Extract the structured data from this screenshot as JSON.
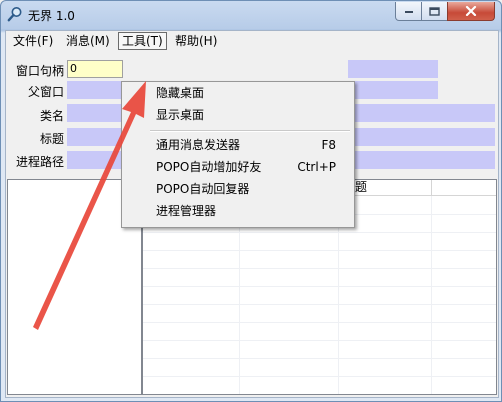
{
  "window": {
    "title": "无界 1.0"
  },
  "menu": {
    "file": "文件(F)",
    "message": "消息(M)",
    "tools": "工具(T)",
    "help": "帮助(H)"
  },
  "fields": {
    "hwnd_label": "窗口句柄",
    "hwnd_value": "0",
    "parent_label": "父窗口",
    "class_label": "类名",
    "title_label": "标题",
    "path_label": "进程路径"
  },
  "list": {
    "title_column": "标题"
  },
  "tools_menu": {
    "items": [
      {
        "label": "隐藏桌面",
        "shortcut": ""
      },
      {
        "label": "显示桌面",
        "shortcut": ""
      },
      {
        "label": "通用消息发送器",
        "shortcut": "F8"
      },
      {
        "label": "POPO自动增加好友",
        "shortcut": "Ctrl+P"
      },
      {
        "label": "POPO自动回复器",
        "shortcut": ""
      },
      {
        "label": "进程管理器",
        "shortcut": ""
      }
    ]
  },
  "colors": {
    "field_fill": "#c8c8f8",
    "hwnd_fill": "#ffffc8",
    "arrow": "#e8463a",
    "close_button": "#c74a38"
  },
  "icons": [
    "magnifier-icon",
    "minimize-icon",
    "maximize-icon",
    "close-icon",
    "red-arrow-annotation"
  ]
}
